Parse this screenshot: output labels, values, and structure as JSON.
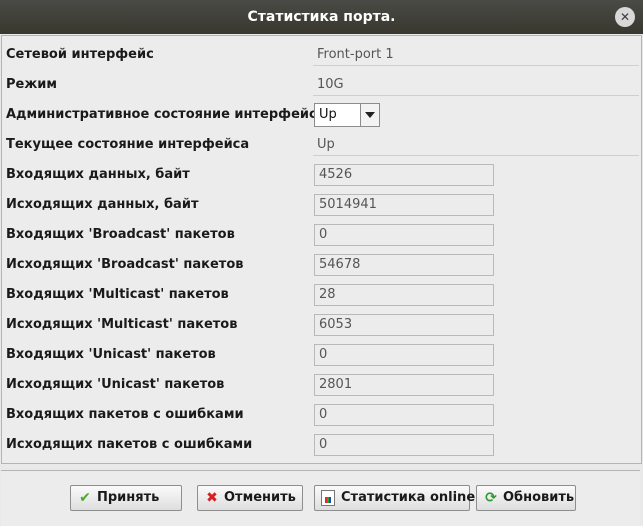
{
  "window": {
    "title": "Статистика порта.",
    "close_glyph": "✕"
  },
  "fields": {
    "interface": {
      "label": "Сетевой интерфейс",
      "value": "Front-port 1"
    },
    "mode": {
      "label": "Режим",
      "value": "10G"
    },
    "admin_state": {
      "label": "Административное состояние интерфейса",
      "value": "Up"
    },
    "current_state": {
      "label": "Текущее состояние интерфейса",
      "value": "Up"
    },
    "rx_bytes": {
      "label": "Входящих данных, байт",
      "value": "4526"
    },
    "tx_bytes": {
      "label": "Исходящих данных, байт",
      "value": "5014941"
    },
    "rx_broadcast": {
      "label": "Входящих 'Broadcast' пакетов",
      "value": "0"
    },
    "tx_broadcast": {
      "label": "Исходящих 'Broadcast' пакетов",
      "value": "54678"
    },
    "rx_multicast": {
      "label": "Входящих 'Multicast' пакетов",
      "value": "28"
    },
    "tx_multicast": {
      "label": "Исходящих 'Multicast' пакетов",
      "value": "6053"
    },
    "rx_unicast": {
      "label": "Входящих 'Unicast' пакетов",
      "value": "0"
    },
    "tx_unicast": {
      "label": "Исходящих 'Unicast' пакетов",
      "value": "2801"
    },
    "rx_errors": {
      "label": "Входящих пакетов с ошибками",
      "value": "0"
    },
    "tx_errors": {
      "label": "Исходящих пакетов с ошибками",
      "value": "0"
    }
  },
  "buttons": {
    "accept": {
      "label": "Принять",
      "icon": "check-icon"
    },
    "cancel": {
      "label": "Отменить",
      "icon": "x-icon"
    },
    "online_stats": {
      "label": "Статистика online",
      "icon": "report-icon"
    },
    "refresh": {
      "label": "Обновить",
      "icon": "refresh-icon"
    }
  },
  "colors": {
    "titlebar": "#3f3f3a",
    "check_green": "#4caa2e",
    "cancel_red": "#d82020"
  }
}
